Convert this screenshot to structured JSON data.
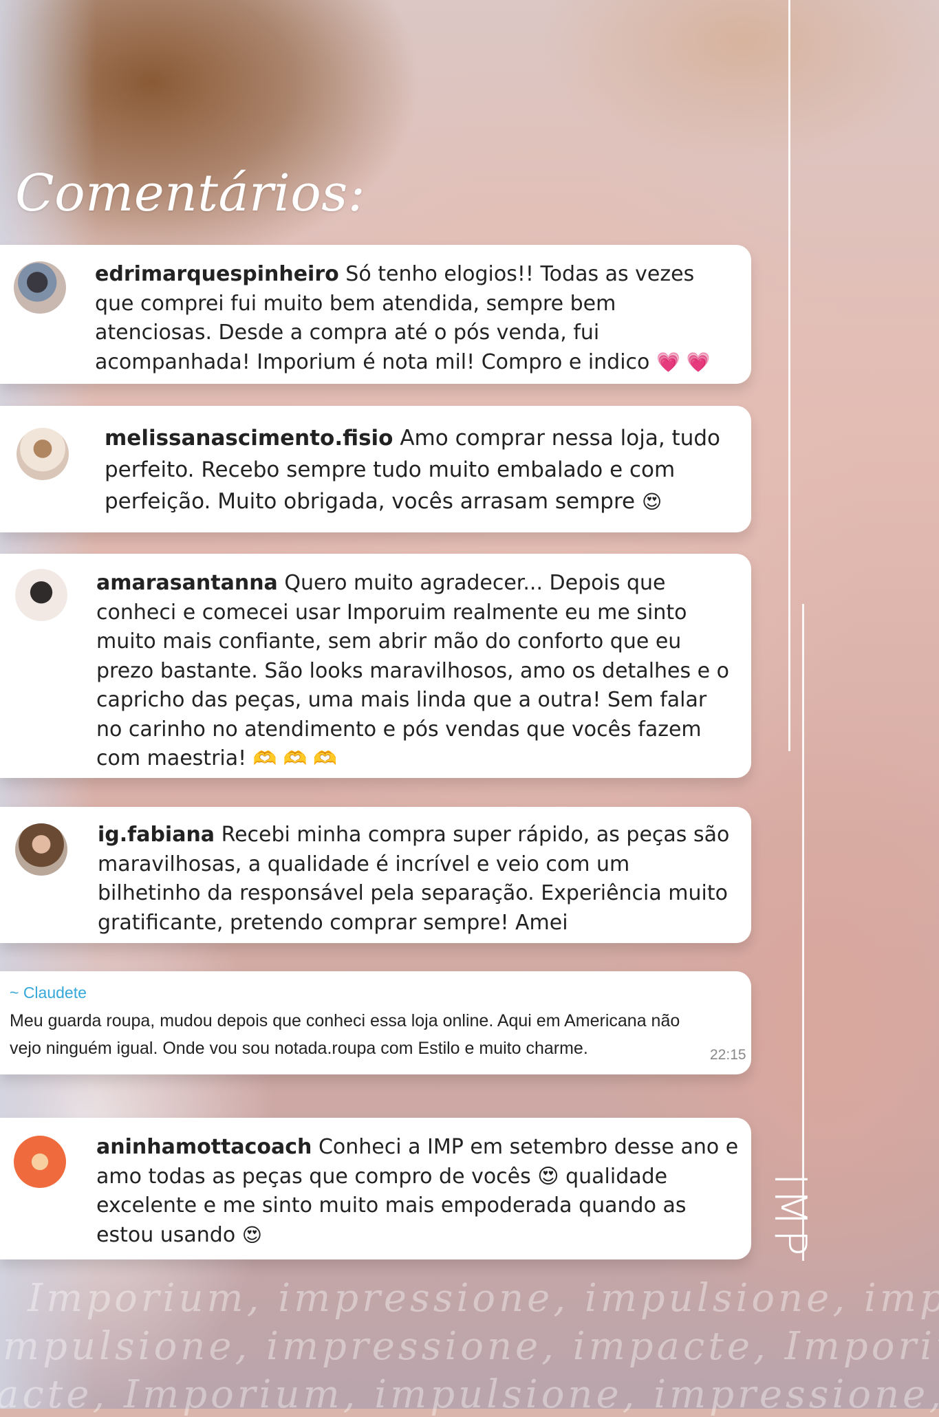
{
  "title": "Comentários:",
  "comments": [
    {
      "user": "edrimarquespinheiro",
      "text": " Só tenho elogios!! Todas as vezes que comprei fui muito bem atendida, sempre bem atenciosas. Desde a compra até o pós venda, fui acompanhada! Imporium é nota mil! Compro e indico",
      "emoji": "💗 💗"
    },
    {
      "user": "melissanascimento.fisio",
      "text": " Amo comprar nessa loja, tudo perfeito. Recebo sempre tudo muito embalado e com perfeição. Muito obrigada, vocês arrasam sempre",
      "emoji": "😍"
    },
    {
      "user": "amarasantanna",
      "text": " Quero muito agradecer... Depois que conheci e comecei usar Imporuim realmente eu me sinto muito mais confiante, sem abrir mão do conforto que eu prezo bastante. São looks maravilhosos, amo os detalhes e o capricho das peças, uma mais linda que a outra! Sem falar no carinho no atendimento e pós vendas que vocês fazem com maestria!",
      "emoji": "🫶 🫶 🫶"
    },
    {
      "user": "ig.fabiana",
      "text": " Recebi minha compra super rápido, as peças são maravilhosas, a qualidade é incrível e veio com um bilhetinho da responsável pela separação. Experiência muito gratificante, pretendo comprar sempre! Amei",
      "emoji": ""
    },
    {
      "user": "aninhamottacoach",
      "text": " Conheci a IMP em setembro desse ano e amo todas as peças que compro de vocês 😍 qualidade excelente e me sinto muito mais empoderada quando as estou usando",
      "emoji": "😍"
    }
  ],
  "whatsapp": {
    "sender": "~ Claudete",
    "text": "Meu guarda roupa, mudou depois que conheci essa loja online. Aqui em Americana não vejo ninguém igual. Onde vou sou notada.roupa com Estilo e muito charme.",
    "time": "22:15"
  },
  "brand": "IMP",
  "watermark": [
    "Imporium, impressione, impulsione, impacte",
    "mpulsione, impressione, impacte, Imporium, i",
    "acte, Imporium, impulsione, impressione, Im"
  ],
  "colors": {
    "card": "#ffffff",
    "sender": "#35a8d8",
    "text": "#222222"
  }
}
